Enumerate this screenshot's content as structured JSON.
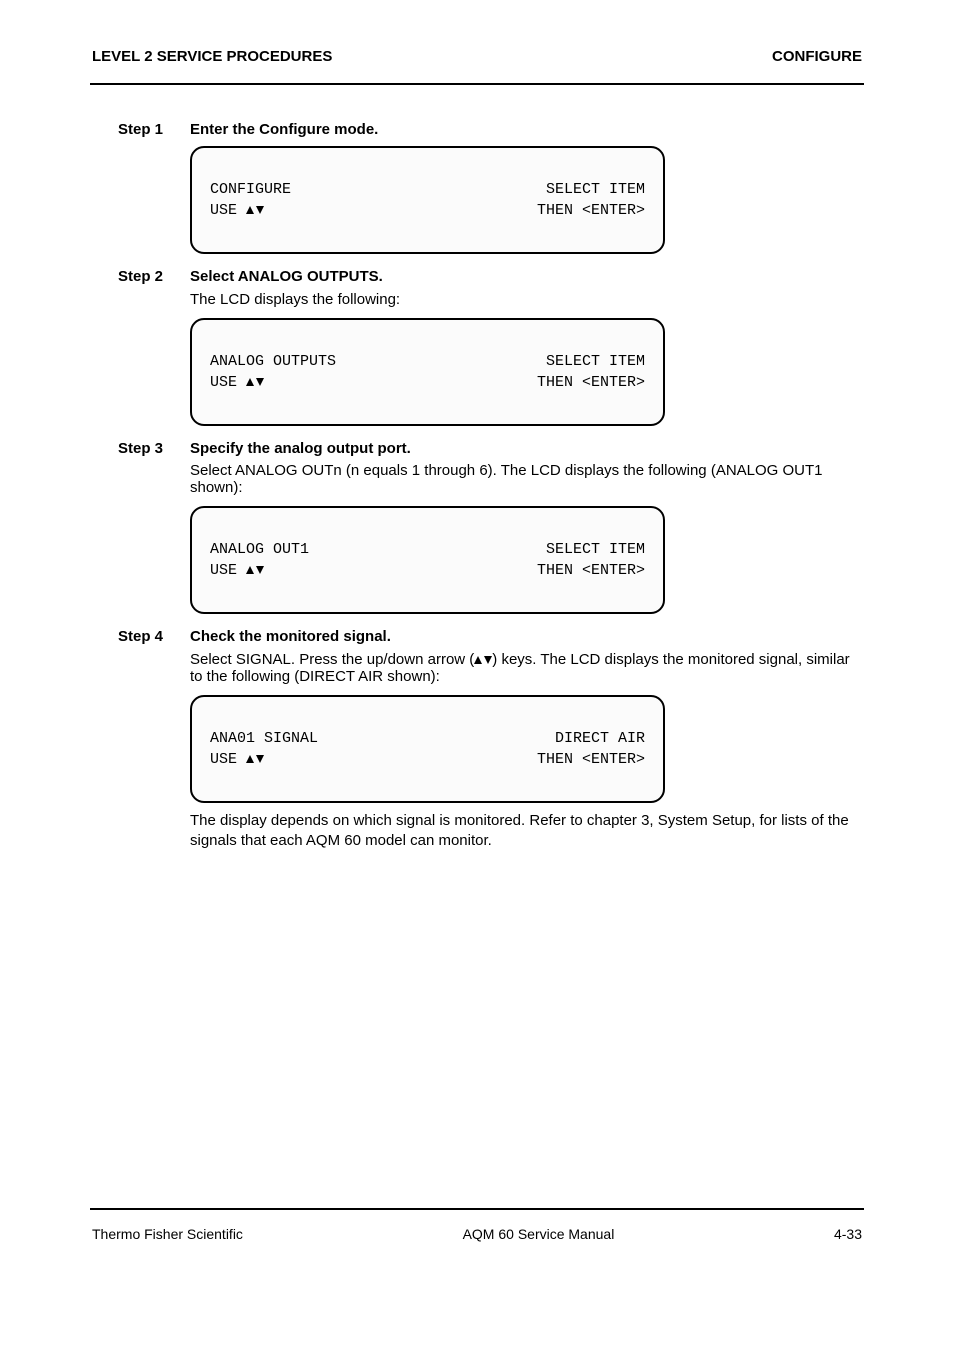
{
  "header": {
    "left": "LEVEL 2 SERVICE PROCEDURES",
    "right": "CONFIGURE"
  },
  "step1": {
    "label": "Step 1",
    "text": "Enter the Configure mode.",
    "lcd": {
      "line1_left": "CONFIGURE",
      "line1_right": "SELECT ITEM",
      "line2_left": "USE",
      "line2_right": "THEN <ENTER>"
    }
  },
  "step2": {
    "label": "Step 2",
    "text": "Select ANALOG OUTPUTS.",
    "subnote": "The LCD displays the following:",
    "lcd": {
      "line1_left": "ANALOG OUTPUTS",
      "line1_right": "SELECT ITEM",
      "line2_left": "USE",
      "line2_right": "THEN <ENTER>"
    }
  },
  "step3": {
    "label": "Step 3",
    "text": "Specify the analog output port.",
    "subnote": "Select ANALOG OUTn (n equals 1 through 6). The LCD displays the following (ANALOG OUT1 shown):",
    "lcd": {
      "line1_left": "ANALOG OUT1",
      "line1_right": "SELECT ITEM",
      "line2_left": "USE",
      "line2_right": "THEN <ENTER>"
    }
  },
  "step4": {
    "label": "Step 4",
    "text": "Check the monitored signal.",
    "subnote": "Select SIGNAL. The LCD displays the monitored signal, similar to the following (DIRECT AIR shown):",
    "lcd": {
      "line1_left": "ANA01 SIGNAL",
      "line1_right": "DIRECT AIR",
      "line2_left": "USE",
      "line2_right": "THEN <ENTER>"
    },
    "resultnote": "The display depends on which signal is monitored. Refer to chapter 3, System Setup, for lists of the signals that each AQM 60 model can monitor."
  },
  "footer": {
    "left": "Thermo Fisher Scientific",
    "center": "AQM 60 Service Manual",
    "right": "4-33"
  }
}
